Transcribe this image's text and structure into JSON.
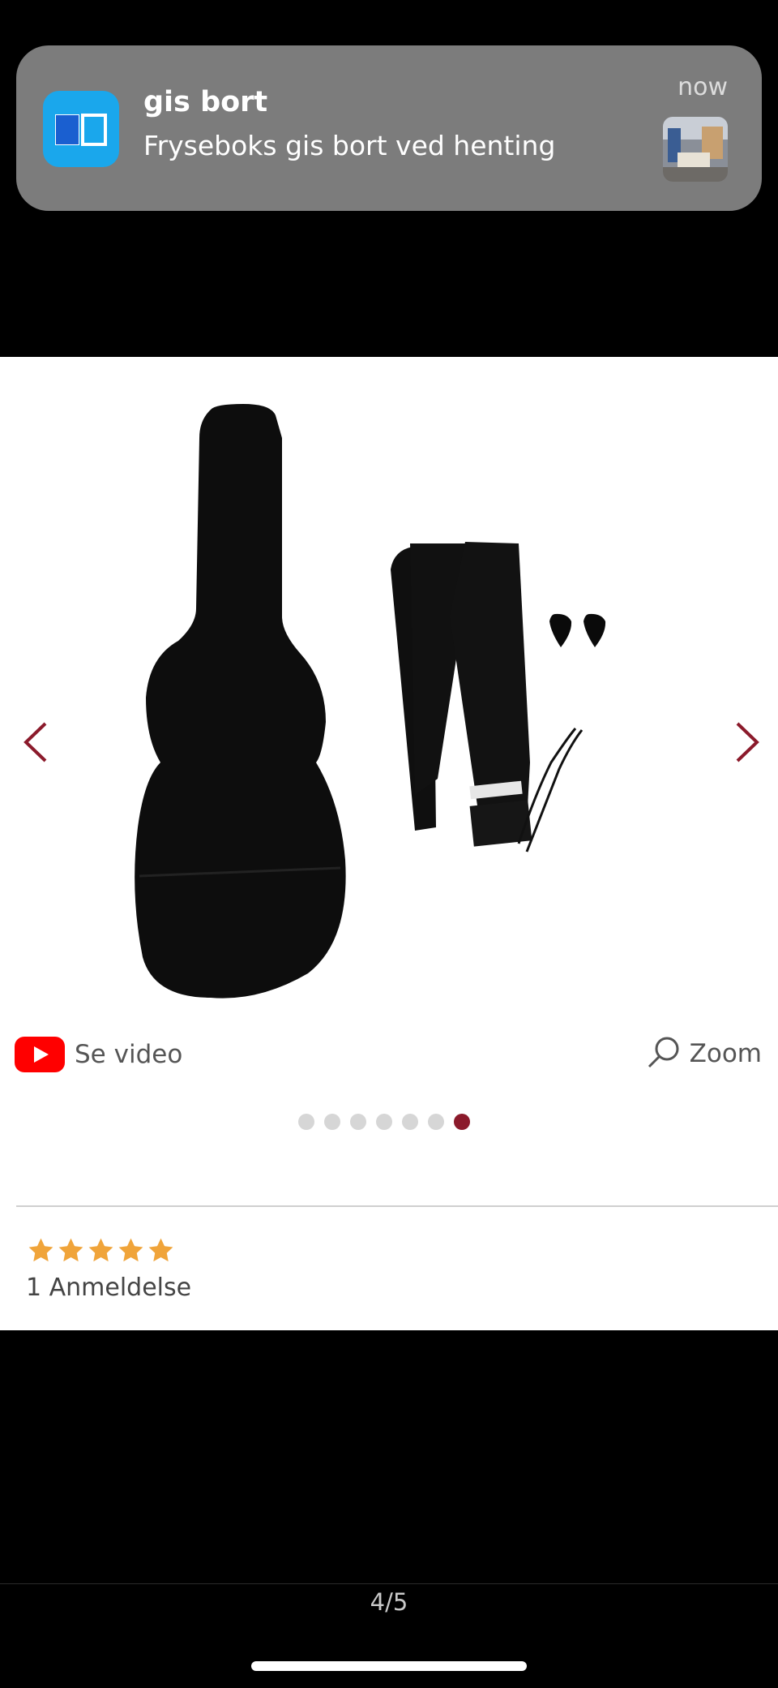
{
  "notification": {
    "app_name": "gis bort",
    "message": "Fryseboks gis bort ved henting",
    "time": "now",
    "app_icon": "book-icon",
    "accent": "#1aa7ec"
  },
  "product": {
    "video_label": "Se video",
    "zoom_label": "Zoom",
    "carousel": {
      "total": 7,
      "active_index": 6
    },
    "rating": {
      "stars": 5,
      "max": 5,
      "reviews_label": "1 Anmeldelse",
      "star_color": "#f0a43a"
    },
    "accent": "#8b1a2b"
  },
  "viewer": {
    "page_counter": "4/5"
  }
}
